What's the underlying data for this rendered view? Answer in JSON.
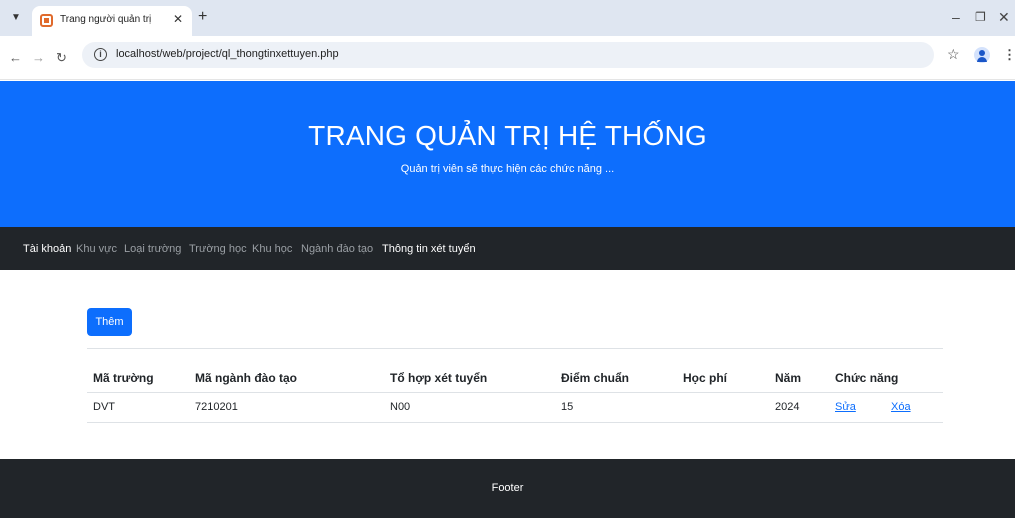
{
  "browser": {
    "tab_title": "Trang người quản trị",
    "url": "localhost/web/project/ql_thongtinxettuyen.php"
  },
  "hero": {
    "title": "TRANG QUẢN TRỊ HỆ THỐNG",
    "subtitle": "Quản trị viên sẽ thực hiện các chức năng ..."
  },
  "nav": {
    "items": [
      {
        "label": "Tài khoản"
      },
      {
        "label": "Khu vực"
      },
      {
        "label": "Loại trường"
      },
      {
        "label": "Trường học"
      },
      {
        "label": "Khu học"
      },
      {
        "label": "Ngành đào tạo"
      },
      {
        "label": "Thông tin xét tuyển"
      }
    ]
  },
  "add_button": "Thêm",
  "table": {
    "headers": [
      "Mã trường",
      "Mã ngành đào tạo",
      "Tổ hợp xét tuyển",
      "Điểm chuẩn",
      "Học phí",
      "Năm",
      "Chức năng"
    ],
    "rows": [
      {
        "ma_truong": "DVT",
        "ma_nganh": "7210201",
        "to_hop": "N00",
        "diem_chuan": "15",
        "hoc_phi": "",
        "nam": "2024",
        "edit_label": "Sửa",
        "delete_label": "Xóa"
      }
    ]
  },
  "footer": "Footer",
  "colors": {
    "primary": "#0d6efd",
    "dark": "#212529"
  }
}
